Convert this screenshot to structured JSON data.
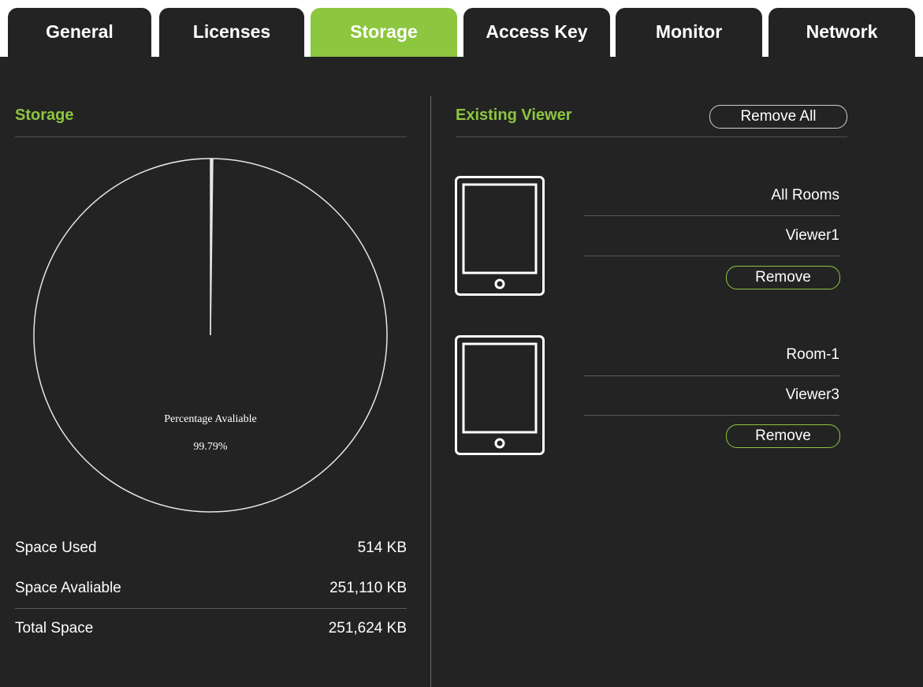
{
  "tabs": [
    {
      "label": "General",
      "active": false
    },
    {
      "label": "Licenses",
      "active": false
    },
    {
      "label": "Storage",
      "active": true
    },
    {
      "label": "Access Key",
      "active": false
    },
    {
      "label": "Monitor",
      "active": false
    },
    {
      "label": "Network",
      "active": false
    }
  ],
  "storage": {
    "title": "Storage",
    "chart_label": "Percentage Avaliable",
    "chart_value": "99.79%",
    "percent_available": 99.79,
    "space_used_label": "Space Used",
    "space_used_value": "514 KB",
    "space_available_label": "Space Avaliable",
    "space_available_value": "251,110 KB",
    "total_space_label": "Total Space",
    "total_space_value": "251,624 KB"
  },
  "viewers": {
    "title": "Existing Viewer",
    "remove_all_label": "Remove All",
    "items": [
      {
        "room": "All Rooms",
        "name": "Viewer1",
        "remove_label": "Remove"
      },
      {
        "room": "Room-1",
        "name": "Viewer3",
        "remove_label": "Remove"
      }
    ]
  },
  "colors": {
    "accent": "#8dc63f",
    "panel_bg": "#232323",
    "text": "#ffffff"
  }
}
